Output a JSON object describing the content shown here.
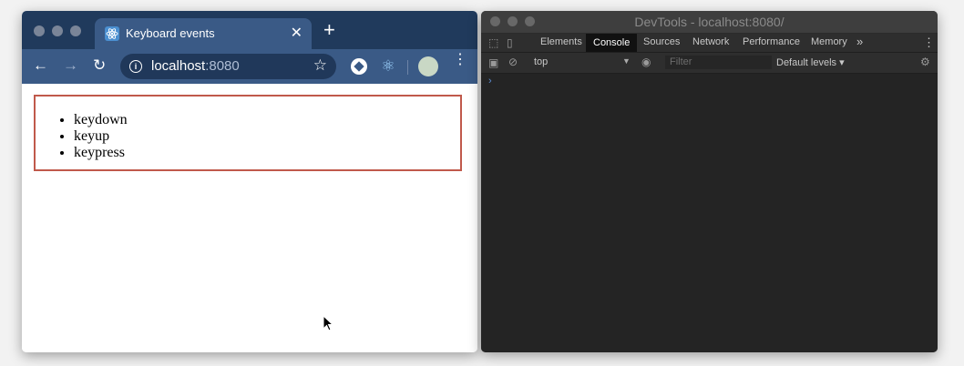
{
  "browser": {
    "tab": {
      "title": "Keyboard events",
      "favicon": "react-icon",
      "close_glyph": "✕"
    },
    "new_tab_glyph": "+",
    "toolbar": {
      "back_glyph": "←",
      "forward_glyph": "→",
      "reload_glyph": "↻",
      "url_host": "localhost",
      "url_port": ":8080",
      "star_glyph": "☆",
      "menu_glyph": "⋮"
    },
    "page": {
      "events": [
        "keydown",
        "keyup",
        "keypress"
      ]
    }
  },
  "devtools": {
    "window_title": "DevTools - localhost:8080/",
    "tabs": [
      "Elements",
      "Console",
      "Sources",
      "Network",
      "Performance",
      "Memory"
    ],
    "active_tab": "Console",
    "more_tabs_glyph": "»",
    "context": "top",
    "filter_placeholder": "Filter",
    "levels": "Default levels ▾",
    "prompt": "›"
  },
  "colors": {
    "tabstrip": "#203a5c",
    "toolbar": "#3a5a86",
    "event_box_border": "#c0594b",
    "devtools_bg": "#242424"
  }
}
